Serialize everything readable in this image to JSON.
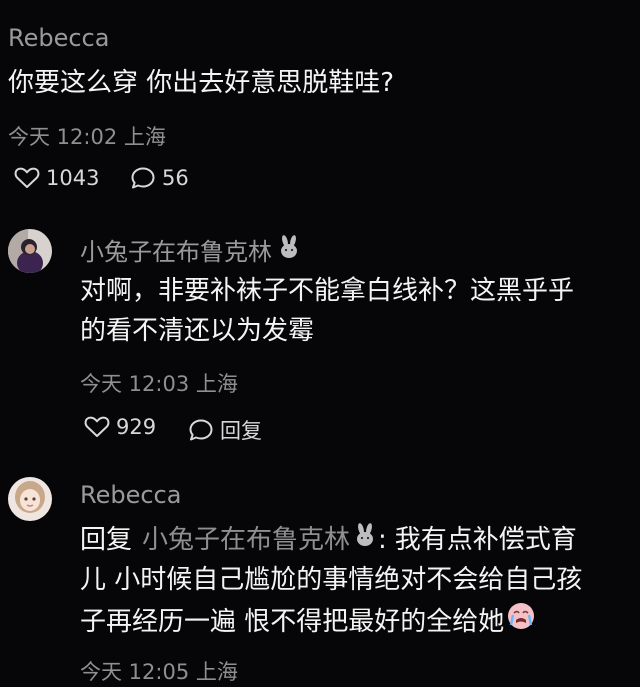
{
  "comments": [
    {
      "author": "Rebecca",
      "text": "你要这么穿 你出去好意思脱鞋哇?",
      "time": "今天 12:02 上海",
      "likes": "1043",
      "replies": "56"
    },
    {
      "author": "小兔子在布鲁克林",
      "text_line1": "对啊，非要补袜子不能拿白线补？这黑乎乎",
      "text_line2": "的看不清还以为发霉",
      "time": "今天 12:03 上海",
      "likes": "929",
      "reply_label": "回复",
      "avatar_icon": "girl-avatar",
      "badge_icon": "rabbit-emoji"
    },
    {
      "author": "Rebecca",
      "reply_prefix": "回复",
      "reply_to": "小兔子在布鲁克林",
      "reply_colon": ":",
      "text_line1_rest": "我有点补偿式育",
      "text_line2": "儿 小时候自己尴尬的事情绝对不会给自己孩",
      "text_line3": "子再经历一遍 恨不得把最好的全给她",
      "time": "今天 12:05 上海",
      "avatar_icon": "doll-avatar",
      "badge_icon": "rabbit-emoji",
      "end_icon": "crying-emoji"
    }
  ]
}
